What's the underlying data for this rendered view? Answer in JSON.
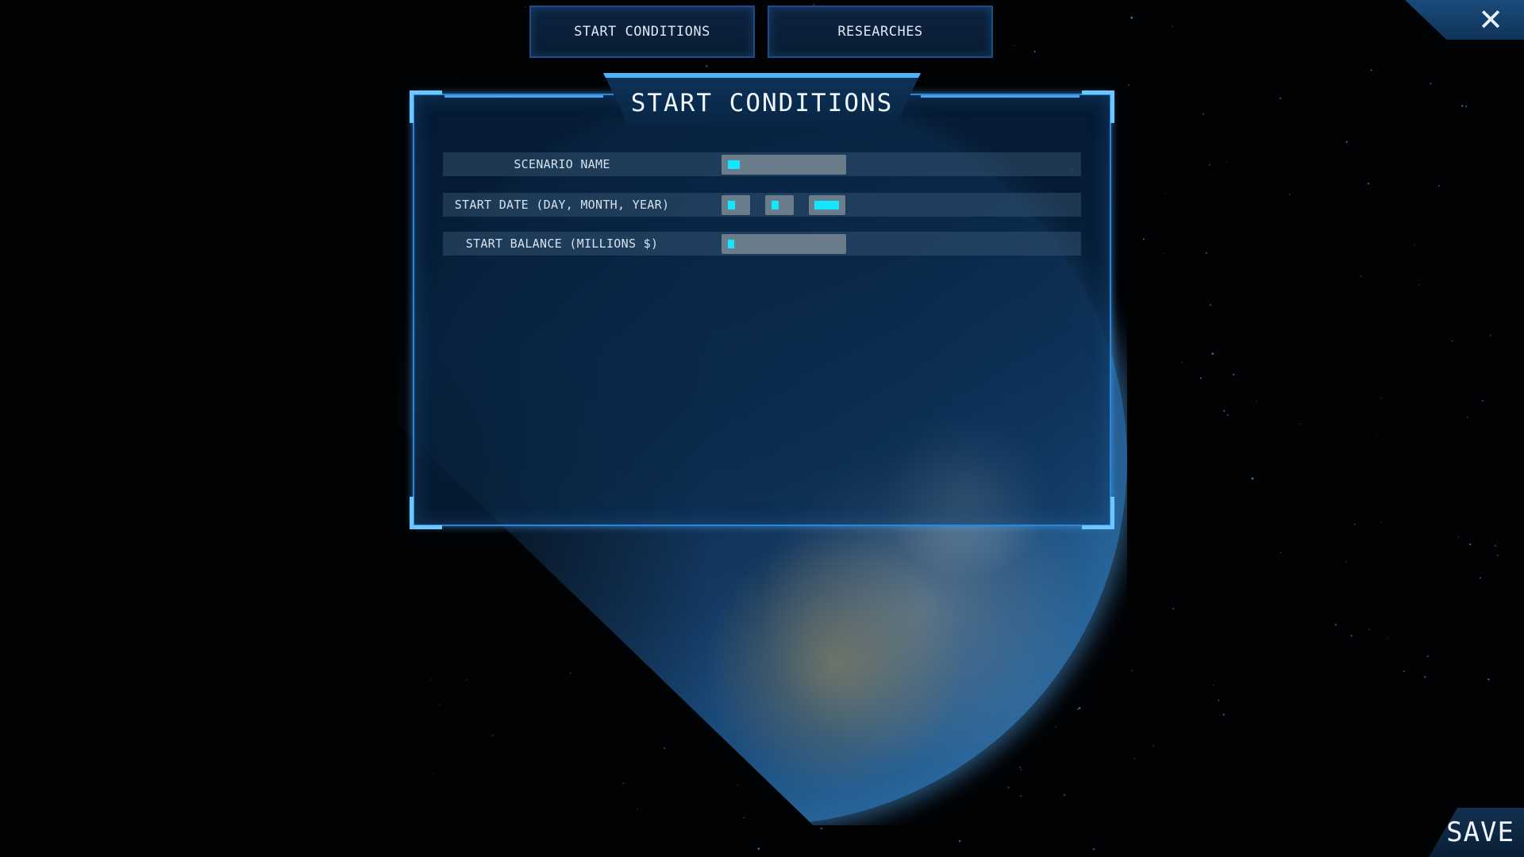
{
  "tabs": [
    {
      "label": "START CONDITIONS",
      "active": true
    },
    {
      "label": "RESEARCHES",
      "active": false
    }
  ],
  "panel": {
    "title": "START CONDITIONS",
    "rows": [
      {
        "label": "SCENARIO NAME",
        "value": ""
      },
      {
        "label": "START DATE (DAY, MONTH, YEAR)",
        "day": "",
        "month": "",
        "year": ""
      },
      {
        "label": "START BALANCE (MILLIONS $)",
        "value": ""
      }
    ]
  },
  "buttons": {
    "save_label": "SAVE",
    "close_icon": "close-icon"
  },
  "colors": {
    "accent": "#2c86d8",
    "caret": "#13e6ff",
    "panel_bg": "#082645"
  }
}
